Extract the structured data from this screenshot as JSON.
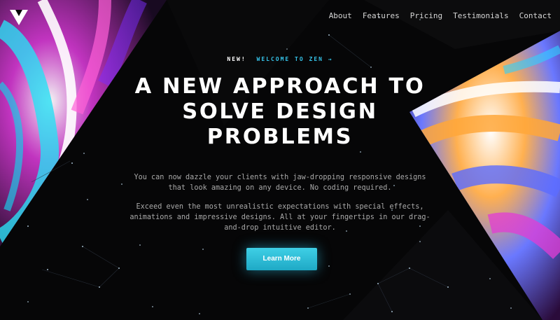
{
  "nav": {
    "items": [
      {
        "label": "About"
      },
      {
        "label": "Features"
      },
      {
        "label": "Pricing"
      },
      {
        "label": "Testimonials"
      },
      {
        "label": "Contact"
      }
    ]
  },
  "hero": {
    "badge_new": "NEW!",
    "badge_link": "WELCOME TO ZEN →",
    "headline": "A NEW APPROACH TO SOLVE DESIGN PROBLEMS",
    "paragraph_1": "You can now dazzle your clients with jaw-dropping responsive designs that look amazing on any device. No coding required.",
    "paragraph_2": "Exceed even the most unrealistic expectations with special effects, animations and impressive designs. All at your fingertips in our drag-and-drop intuitive editor.",
    "cta_label": "Learn More"
  },
  "colors": {
    "accent": "#35c2e8",
    "background": "#060607",
    "cta": "#2bbad6"
  },
  "icons": {
    "logo": "triangle-logo-icon"
  }
}
